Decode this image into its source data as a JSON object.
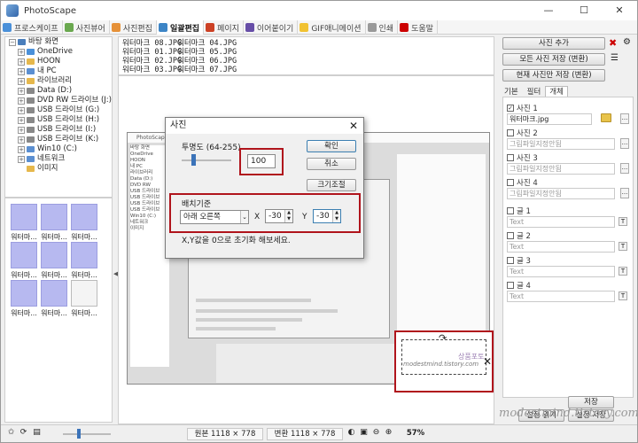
{
  "app": {
    "title": "PhotoScape"
  },
  "window_controls": [
    "—",
    "☐",
    "✕"
  ],
  "tabs": [
    {
      "label": "프로스케이프",
      "color": "#4a90d9"
    },
    {
      "label": "사진뷰어",
      "color": "#6aa84f"
    },
    {
      "label": "사진편집",
      "color": "#e69138"
    },
    {
      "label": "일괄편집",
      "color": "#3d85c6"
    },
    {
      "label": "페이지",
      "color": "#cc4125"
    },
    {
      "label": "이어붙이기",
      "color": "#674ea7"
    },
    {
      "label": "GIF애니메이션",
      "color": "#f1c232"
    },
    {
      "label": "인쇄",
      "color": "#999999"
    },
    {
      "label": "도움말",
      "color": "#cc0000"
    }
  ],
  "tree": [
    {
      "label": "바탕 화면",
      "exp": "−",
      "color": "#4a7ebb",
      "indent": 0
    },
    {
      "label": "OneDrive",
      "exp": "+",
      "color": "#4a90d9",
      "indent": 1
    },
    {
      "label": "HOON",
      "exp": "+",
      "color": "#e6b84c",
      "indent": 1
    },
    {
      "label": "내 PC",
      "exp": "+",
      "color": "#5b8fd1",
      "indent": 1
    },
    {
      "label": "라이브러리",
      "exp": "+",
      "color": "#e6b84c",
      "indent": 1
    },
    {
      "label": "Data (D:)",
      "exp": "+",
      "color": "#888888",
      "indent": 1
    },
    {
      "label": "DVD RW 드라이브 (J:)",
      "exp": "+",
      "color": "#888888",
      "indent": 1
    },
    {
      "label": "USB 드라이브 (G:)",
      "exp": "+",
      "color": "#888888",
      "indent": 1
    },
    {
      "label": "USB 드라이브 (H:)",
      "exp": "+",
      "color": "#888888",
      "indent": 1
    },
    {
      "label": "USB 드라이브 (I:)",
      "exp": "+",
      "color": "#888888",
      "indent": 1
    },
    {
      "label": "USB 드라이브 (K:)",
      "exp": "+",
      "color": "#888888",
      "indent": 1
    },
    {
      "label": "Win10 (C:)",
      "exp": "+",
      "color": "#5b8fd1",
      "indent": 1
    },
    {
      "label": "네트워크",
      "exp": "+",
      "color": "#5b8fd1",
      "indent": 1
    },
    {
      "label": "이미지",
      "exp": "",
      "color": "#e6b84c",
      "indent": 1
    }
  ],
  "thumbnails": [
    {
      "caption": "워터마...",
      "doc": false
    },
    {
      "caption": "워터마...",
      "doc": false
    },
    {
      "caption": "워터마...",
      "doc": false
    },
    {
      "caption": "워터마...",
      "doc": false
    },
    {
      "caption": "워터마...",
      "doc": false
    },
    {
      "caption": "워터마...",
      "doc": false
    },
    {
      "caption": "워터마...",
      "doc": false
    },
    {
      "caption": "워터마...",
      "doc": false
    },
    {
      "caption": "워터마...",
      "doc": true
    }
  ],
  "files": {
    "col1": [
      "워터마크 08.JPG",
      "워터마크 01.JPG",
      "워터마크 02.JPG",
      "워터마크 03.JPG"
    ],
    "col2": [
      "워터마크 04.JPG",
      "워터마크 05.JPG",
      "워터마크 06.JPG",
      "워터마크 07.JPG"
    ]
  },
  "sidebar": {
    "add_photo": "사진 추가",
    "save_all": "모든 사진 저장 (변환)",
    "save_current": "현재 사진만 저장 (변환)",
    "subtabs": [
      "기본",
      "필터",
      "개체"
    ],
    "photo_items": [
      {
        "label": "사진 1",
        "checked": true,
        "value": "워터마크.jpg",
        "filled": true
      },
      {
        "label": "사진 2",
        "checked": false,
        "value": "그림파일지정안됨",
        "filled": false
      },
      {
        "label": "사진 3",
        "checked": false,
        "value": "그림파일지정안됨",
        "filled": false
      },
      {
        "label": "사진 4",
        "checked": false,
        "value": "그림파일지정안됨",
        "filled": false
      }
    ],
    "text_items": [
      {
        "label": "글 1",
        "value": "Text"
      },
      {
        "label": "글 2",
        "value": "Text"
      },
      {
        "label": "글 3",
        "value": "Text"
      },
      {
        "label": "글 4",
        "value": "Text"
      }
    ],
    "bottom_buttons": [
      "저장",
      "설정 읽기",
      "설정 저장"
    ]
  },
  "dialog": {
    "title": "사진",
    "opacity_label": "투명도 (64-255)",
    "opacity_value": "100",
    "opacity_level": 0.19,
    "ok": "확인",
    "cancel": "취소",
    "resize": "크기조절",
    "position_label": "배치기준",
    "position_select": "아래 오른쪽",
    "x_label": "X",
    "x_value": "-30",
    "y_label": "Y",
    "y_value": "-30",
    "hint": "X,Y값을 0으로 초기화 해보세요."
  },
  "preview": {
    "title": "PhotoScape",
    "tree_items": [
      "바탕 화면",
      "OneDrive",
      "HOON",
      "내 PC",
      "라이브러리",
      "Data (D:)",
      "DVD RW",
      "USB 드라이브",
      "USB 드라이브",
      "USB 드라이브",
      "USB 드라이브",
      "Win10 (C:)",
      "네트워크",
      "이미지"
    ],
    "watermark_text": "modestmind.tistory.com",
    "watermark_stamp": "상품포토"
  },
  "status": {
    "original": "원본 1118 × 778",
    "converted": "변환 1118 × 778",
    "zoom": "57%"
  },
  "watermark": "modestmind.tistory.com"
}
